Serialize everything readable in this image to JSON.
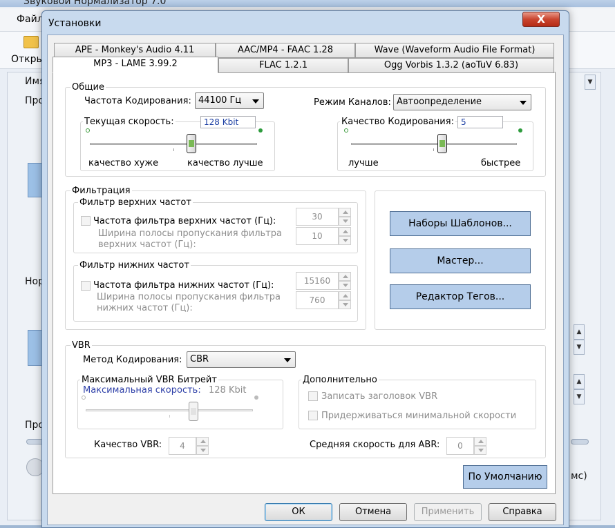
{
  "main_window": {
    "title": "Звуковой Нормализатор 7.0",
    "menu_file": "Файл",
    "open_label": "Откры",
    "labels": {
      "name": "Имя",
      "pro1": "Про",
      "nor": "Нор",
      "pro2": "Про",
      "tail": "мс)"
    }
  },
  "dialog": {
    "title": "Установки",
    "close": "X",
    "tabs_row_back": [
      {
        "label": "APE - Monkey's Audio 4.11"
      },
      {
        "label": "AAC/MP4 - FAAC 1.28"
      },
      {
        "label": "Wave (Waveform Audio File Format)"
      }
    ],
    "tabs_row_front": [
      {
        "label": "MP3 - LAME 3.99.2",
        "active": true
      },
      {
        "label": "FLAC 1.2.1"
      },
      {
        "label": "Ogg Vorbis 1.3.2 (aoTuV 6.83)"
      }
    ],
    "general": {
      "title": "Общие",
      "freq_label": "Частота Кодирования:",
      "freq_value": "44100 Гц",
      "channel_label": "Режим Каналов:",
      "channel_value": "Автоопределение",
      "bitrate_label": "Текущая скорость:",
      "bitrate_value": "128 Kbit",
      "bitrate_left": "качество хуже",
      "bitrate_right": "качество лучше",
      "bitrate_level": 0.5,
      "quality_label": "Качество Кодирования:",
      "quality_value": "5",
      "quality_left": "лучше",
      "quality_right": "быстрее",
      "quality_level": 0.5
    },
    "filter": {
      "title": "Фильтрация",
      "high": {
        "title": "Фильтр верхних частот",
        "check_label": "Частота фильтра верхних частот (Гц):",
        "freq_value": "30",
        "width_label_1": "Ширина полосы пропускания фильтра",
        "width_label_2": "верхних частот (Гц):",
        "width_value": "10"
      },
      "low": {
        "title": "Фильтр нижних частот",
        "check_label": "Частота фильтра нижних частот (Гц):",
        "freq_value": "15160",
        "width_label_1": "Ширина полосы пропускания фильтра",
        "width_label_2": "нижних частот (Гц):",
        "width_value": "760"
      }
    },
    "side_buttons": {
      "presets": "Наборы Шаблонов...",
      "wizard": "Мастер...",
      "tag_editor": "Редактор Тегов..."
    },
    "vbr": {
      "title": "VBR",
      "method_label": "Метод Кодирования:",
      "method_value": "CBR",
      "max_title": "Максимальный VBR Битрейт",
      "max_label": "Максимальная скорость:",
      "max_value": "128 Kbit",
      "max_level": 0.5,
      "extra_title": "Дополнительно",
      "write_header": "Записать заголовок VBR",
      "strict_min": "Придерживаться минимальной скорости",
      "quality_label": "Качество VBR:",
      "quality_value": "4",
      "abr_label": "Средняя скорость для ABR:",
      "abr_value": "0"
    },
    "defaults_button": "По Умолчанию",
    "footer": {
      "ok": "ОК",
      "cancel": "Отмена",
      "apply": "Применить",
      "help": "Справка"
    }
  }
}
